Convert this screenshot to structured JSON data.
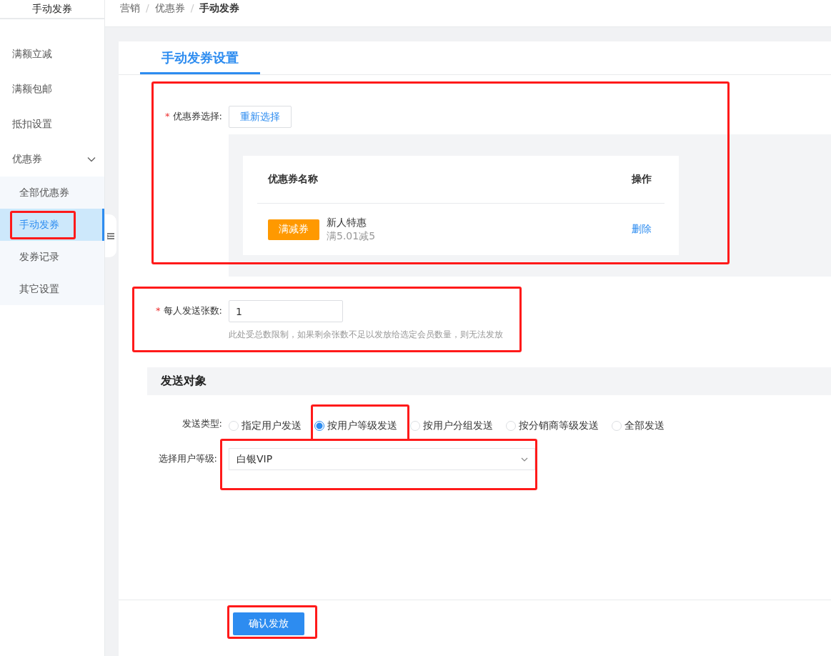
{
  "sidebar": {
    "title": "手动发券",
    "items": [
      {
        "label": "满额立减",
        "selected": false
      },
      {
        "label": "满额包邮",
        "selected": false
      },
      {
        "label": "抵扣设置",
        "selected": false
      },
      {
        "label": "优惠券",
        "selected": false,
        "expanded": true,
        "children": [
          {
            "label": "全部优惠券",
            "selected": false
          },
          {
            "label": "手动发券",
            "selected": true,
            "highlighted": true
          },
          {
            "label": "发券记录",
            "selected": false
          },
          {
            "label": "其它设置",
            "selected": false
          }
        ]
      }
    ]
  },
  "breadcrumb": {
    "separator": "/",
    "items": [
      "营销",
      "优惠券",
      "手动发券"
    ]
  },
  "tabs": [
    {
      "label": "手动发券设置",
      "selected": true
    }
  ],
  "coupon_select": {
    "required_mark": "*",
    "label": "优惠券选择:",
    "button": "重新选择",
    "highlighted": true,
    "table": {
      "columns": [
        "优惠券名称",
        "操作"
      ],
      "rows": [
        {
          "tag": "满减券",
          "name": "新人特惠",
          "condition": "满5.01减5",
          "action": "删除"
        }
      ]
    }
  },
  "per_person": {
    "required_mark": "*",
    "label": "每人发送张数:",
    "value": "1",
    "hint": "此处受总数限制，如果剩余张数不足以发放给选定会员数量，则无法发放",
    "highlighted": true
  },
  "section_title": "发送对象",
  "send_type": {
    "label": "发送类型:",
    "options": [
      {
        "label": "指定用户发送",
        "selected": false
      },
      {
        "label": "按用户等级发送",
        "selected": true,
        "highlighted": true
      },
      {
        "label": "按用户分组发送",
        "selected": false
      },
      {
        "label": "按分销商等级发送",
        "selected": false
      },
      {
        "label": "全部发送",
        "selected": false
      }
    ]
  },
  "user_level": {
    "label": "选择用户等级:",
    "value": "白银VIP",
    "highlighted": true
  },
  "submit": {
    "label": "确认发放",
    "highlighted": true
  }
}
